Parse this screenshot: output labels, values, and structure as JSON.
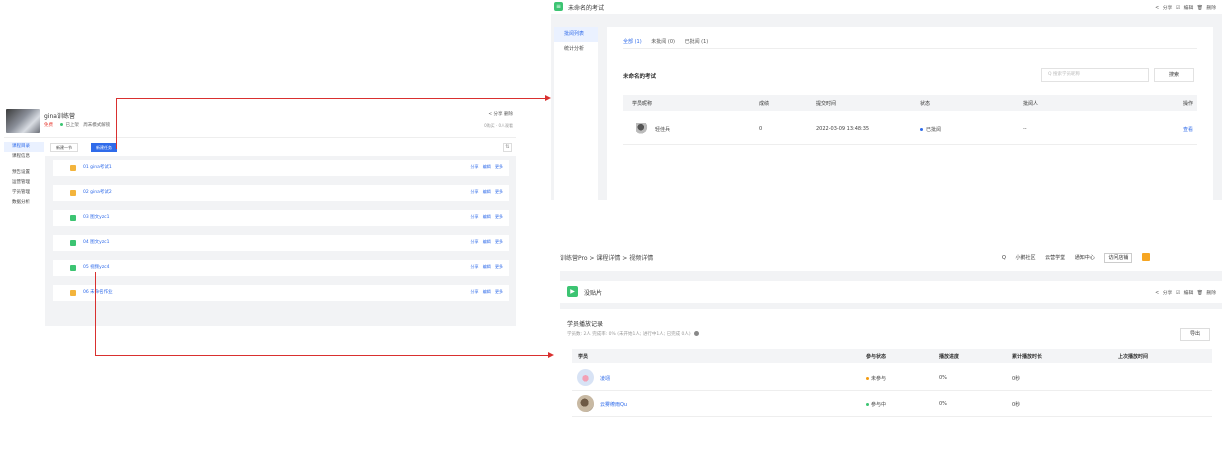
{
  "left_panel": {
    "course_title": "gina训练营",
    "meta_free": "免费",
    "meta_status": "已上架",
    "meta_mode": "周末模式解锁",
    "actions": "< 分享  删除",
    "stats": "0购买 · 0人观看",
    "sidebar": [
      "课程目录",
      "课程信息",
      "",
      "预告设置",
      "运营管理",
      "学员管理",
      "数据分析"
    ],
    "add_chapter": "新建一节",
    "add_task": "新建任务",
    "rows": [
      {
        "label": "01 gina考试1",
        "color": "#f3b43c"
      },
      {
        "label": "02 gina考试2",
        "color": "#f3b43c"
      },
      {
        "label": "03 图文yzc1",
        "color": "#3cc472"
      },
      {
        "label": "04 图文yzc1",
        "color": "#3cc472"
      },
      {
        "label": "05 视频yzc4",
        "color": "#3cc472"
      },
      {
        "label": "06 未命名作业",
        "color": "#f3b43c"
      }
    ],
    "row_actions": "分享 编辑 更多"
  },
  "exam_panel": {
    "title": "未命名的考试",
    "actions": "< 分享  ☑ 编辑  🗑 删除",
    "nav": [
      "批阅列表",
      "统计分析"
    ],
    "tabs": [
      "全部 (1)",
      "未批阅 (0)",
      "已批阅 (1)"
    ],
    "subtitle": "未命名的考试",
    "search_placeholder": "Q 搜索学员昵称",
    "search_button": "搜索",
    "columns": [
      "学员昵称",
      "成绩",
      "提交时间",
      "状态",
      "批阅人",
      "操作"
    ],
    "row": {
      "name": "轻佳兵",
      "score": "0",
      "time": "2022-03-09 13:48:35",
      "status": "已批阅",
      "reviewer": "--",
      "op": "查看"
    }
  },
  "video_panel": {
    "breadcrumb": "训练营Pro  >  课程详情  >  视频详情",
    "top_links": [
      "Q",
      "小鹅社区",
      "云营学堂",
      "通知中心",
      "访问店铺"
    ],
    "title": "没贴片",
    "actions": "< 分享  ☑ 编辑  🗑 删除",
    "card_title": "学员播放记录",
    "card_stats": "学员数: 2人  完成率: 0%  (未开始1人; 进行中1人; 已完成 0人)",
    "export": "导出",
    "columns": [
      "学员",
      "参与状态",
      "播放进度",
      "累计播放时长",
      "上次播放时间"
    ],
    "rows": [
      {
        "name": "凌翊",
        "status": "未参与",
        "status_color": "#f39c12",
        "progress": "0%",
        "duration": "0秒",
        "last": ""
      },
      {
        "name": "云雾缭雨Qu",
        "status": "参与中",
        "status_color": "#3cc472",
        "progress": "0%",
        "duration": "0秒",
        "last": ""
      }
    ]
  }
}
